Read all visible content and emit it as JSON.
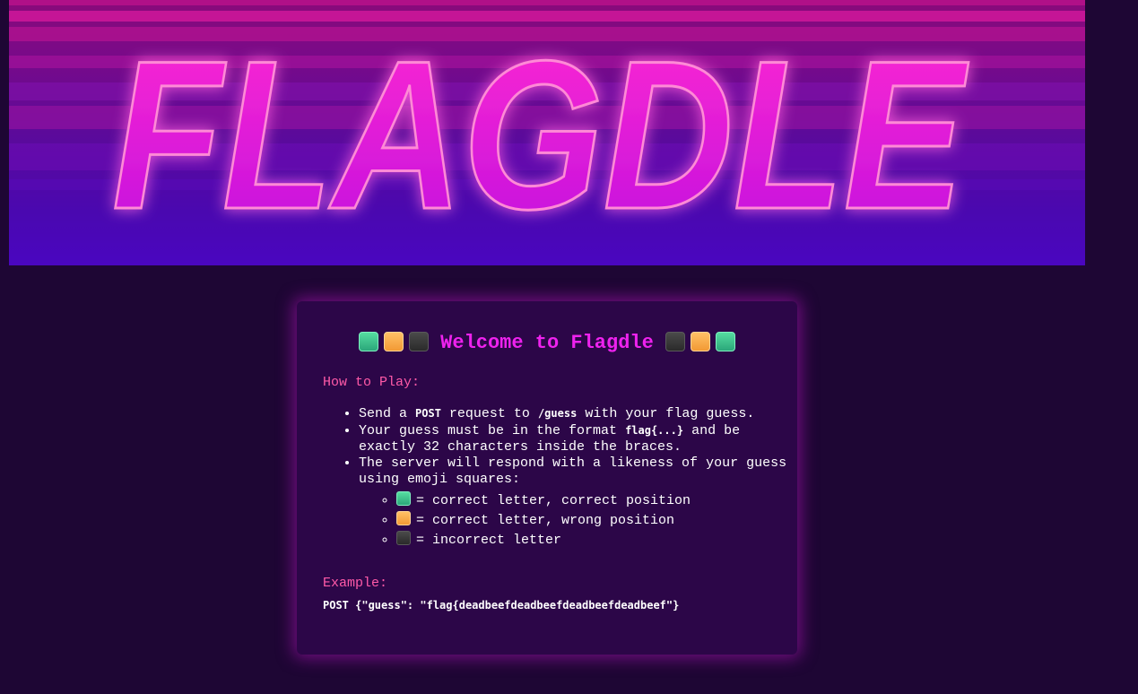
{
  "banner": {
    "title": "FLAGDLE"
  },
  "card": {
    "heading": "Welcome to Flagdle",
    "heading_left_squares": [
      "green",
      "orange",
      "black"
    ],
    "heading_right_squares": [
      "black",
      "orange",
      "green"
    ],
    "how_to_play_label": "How to Play:",
    "rules": {
      "r1_a": "Send a ",
      "r1_code1": "POST",
      "r1_b": " request to ",
      "r1_code2": "/guess",
      "r1_c": " with your flag guess.",
      "r2_a": "Your guess must be in the format ",
      "r2_code": "flag{...}",
      "r2_b": " and be exactly 32 characters inside the braces.",
      "r3": "The server will respond with a likeness of your guess using emoji squares:"
    },
    "legend": [
      {
        "color": "green",
        "text": "= correct letter, correct position"
      },
      {
        "color": "orange",
        "text": "= correct letter, wrong position"
      },
      {
        "color": "black",
        "text": "= incorrect letter"
      }
    ],
    "example_label": "Example:",
    "example_code": "POST {\"guess\": \"flag{deadbeefdeadbeefdeadbeefdeadbeef\"}"
  },
  "colors": {
    "page_bg": "#1e0634",
    "card_bg": "#2c0648",
    "heading": "#ee22ee",
    "label": "#ff5aa8",
    "green_square": "#3cc08a",
    "orange_square": "#f7aa48",
    "black_square": "#3a3a3a"
  }
}
